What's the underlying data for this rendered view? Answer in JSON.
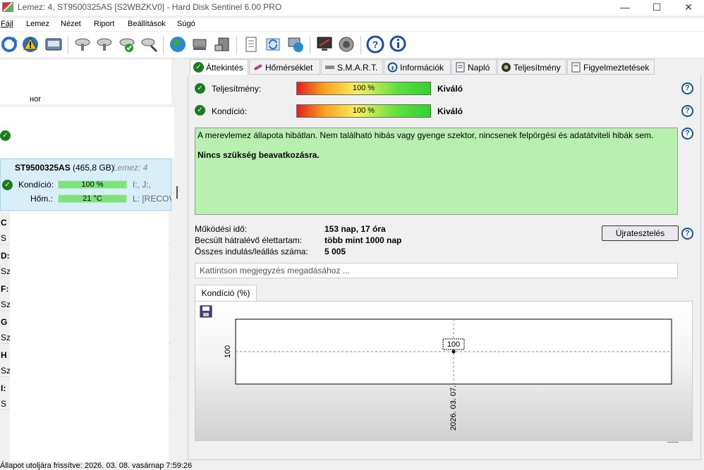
{
  "window": {
    "title": "Lemez: 4, ST9500325AS [S2WBZKV0]  -  Hard Disk Sentinel 6.00 PRO",
    "minimize": "—",
    "maximize": "☐",
    "close": "✕"
  },
  "menu": {
    "items": [
      "Fájl",
      "Lemez",
      "Nézet",
      "Riport",
      "Beállítások",
      "Súgó"
    ]
  },
  "left": {
    "partial_text_1": "ног",
    "disk_name": "ST9500325AS",
    "disk_size": "(465,8 GB)",
    "disk_num": "Lemez: 4",
    "kondicio_label": "Kondíció:",
    "kondicio_value": "100 %",
    "kondicio_drive": "I:, J:,",
    "hom_label": "Hőm.:",
    "hom_value": "21 °C",
    "hom_drive": "L: [RECOV",
    "row_letters": [
      "C",
      "D:",
      "F:",
      "G",
      "H",
      "I:"
    ],
    "row_sub": [
      "S",
      "Sz",
      "Sz",
      "Sz",
      "Sz",
      "S"
    ]
  },
  "tabs": {
    "items": [
      "Áttekintés",
      "Hőmérséklet",
      "S.M.A.R.T.",
      "Információk",
      "Napló",
      "Teljesítmény",
      "Figyelmeztetések"
    ]
  },
  "overview": {
    "perf_label": "Teljesítmény:",
    "perf_value": "100 %",
    "perf_rating": "Kiváló",
    "cond_label": "Kondíció:",
    "cond_value": "100 %",
    "cond_rating": "Kiváló",
    "status_text": "A merevlemez állapota hibátlan. Nem található hibás vagy gyenge szektor, nincsenek felpörgési és adatátviteli hibák sem.",
    "status_bold": "Nincs szükség beavatkozásra.",
    "uptime_label": "Működési idő:",
    "uptime_value": "153 nap, 17 óra",
    "life_label": "Becsült hátralévő élettartam:",
    "life_value": "több mint 1000 nap",
    "starts_label": "Összes indulás/leállás száma:",
    "starts_value": "5 005",
    "retest_button": "Újratesztelés",
    "help": "?",
    "comment_placeholder": "Kattintson megjegyzés megadásához ...",
    "chart_tab": "Kondíció  (%)"
  },
  "chart_data": {
    "type": "line",
    "x": [
      "2026. 03. 07."
    ],
    "series": [
      {
        "values": [
          100
        ]
      }
    ],
    "ytick": "100",
    "data_label": "100"
  },
  "statusbar": {
    "text": "Állapot utoljára frissítve: 2026. 03. 08. vasárnap 7:59:26"
  },
  "colors": {
    "ok_green": "#1e7a1e",
    "status_bg": "#b8f0b0",
    "selected_row": "#d8eef9"
  }
}
